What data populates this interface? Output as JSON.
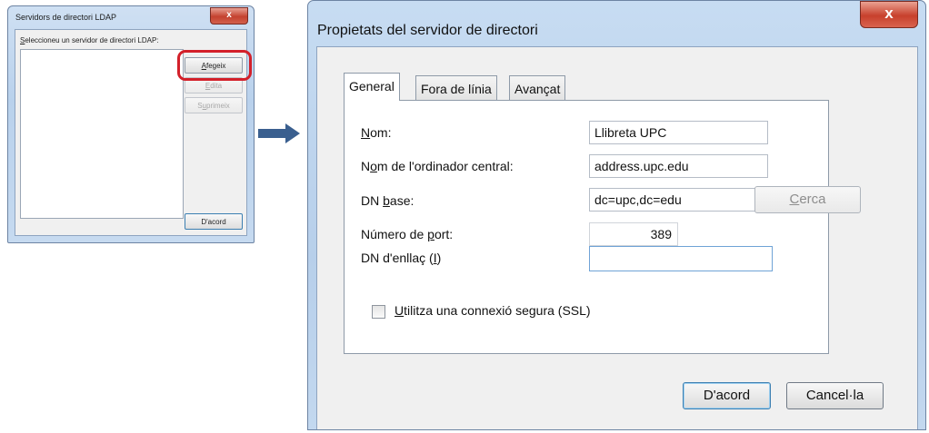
{
  "small_dialog": {
    "title": "Servidors de directori LDAP",
    "close_glyph": "x",
    "label": "Seleccioneu un servidor de directori LDAP:",
    "add_button": "Afegeix",
    "edit_button": "Edita",
    "delete_button": "Suprimeix",
    "ok_button": "D'acord"
  },
  "arrow_icon": "right-arrow-icon",
  "big_dialog": {
    "title": "Propietats del servidor de directori",
    "close_glyph": "x",
    "tabs": [
      {
        "label": "General",
        "active": true
      },
      {
        "label": "Fora de línia",
        "active": false
      },
      {
        "label": "Avançat",
        "active": false
      }
    ],
    "fields": {
      "name_label": "Nom:",
      "name_value": "Llibreta UPC",
      "host_label": "Nom de l'ordinador central:",
      "host_value": "address.upc.edu",
      "basedn_label": "DN base:",
      "basedn_value": "dc=upc,dc=edu",
      "search_button": "Cerca",
      "port_label": "Número de port:",
      "port_value": "389",
      "binddn_label": "DN d'enllaç (I)",
      "binddn_value": ""
    },
    "ssl_label": "Utilitza una connexió segura (SSL)",
    "ssl_checked": false,
    "ok_button": "D'acord",
    "cancel_button": "Cancel·la"
  },
  "colors": {
    "highlight_ring": "#d3202a",
    "arrow": "#3a5f8f",
    "close_button": "#c7402c"
  }
}
